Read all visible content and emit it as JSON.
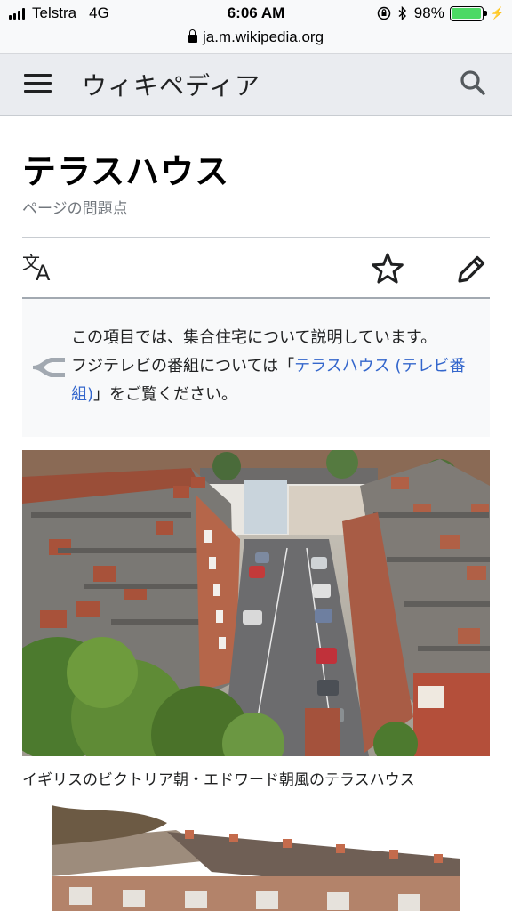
{
  "status_bar": {
    "carrier": "Telstra",
    "network": "4G",
    "time": "6:06 AM",
    "battery_percent": "98%",
    "battery_level": 0.98,
    "icons": [
      "signal-icon",
      "orientation-lock-icon",
      "bluetooth-icon",
      "battery-icon",
      "charging-icon"
    ]
  },
  "browser": {
    "url": "ja.m.wikipedia.org"
  },
  "header": {
    "site_title": "ウィキペディア"
  },
  "article": {
    "title": "テラスハウス",
    "issues_link": "ページの問題点"
  },
  "hatnote": {
    "line1": "この項目では、集合住宅について説明しています。",
    "line2_prefix": "フジテレビの番組については「",
    "link_text": "テラスハウス (テレビ番組)",
    "line2_suffix": "」をご覧ください。"
  },
  "figure": {
    "caption": "イギリスのビクトリア朝・エドワード朝風のテラスハウス"
  },
  "colors": {
    "link": "#3366cc",
    "header_bg": "#eaecf0",
    "hatnote_bg": "#f8f9fa",
    "battery": "#4cd964"
  }
}
